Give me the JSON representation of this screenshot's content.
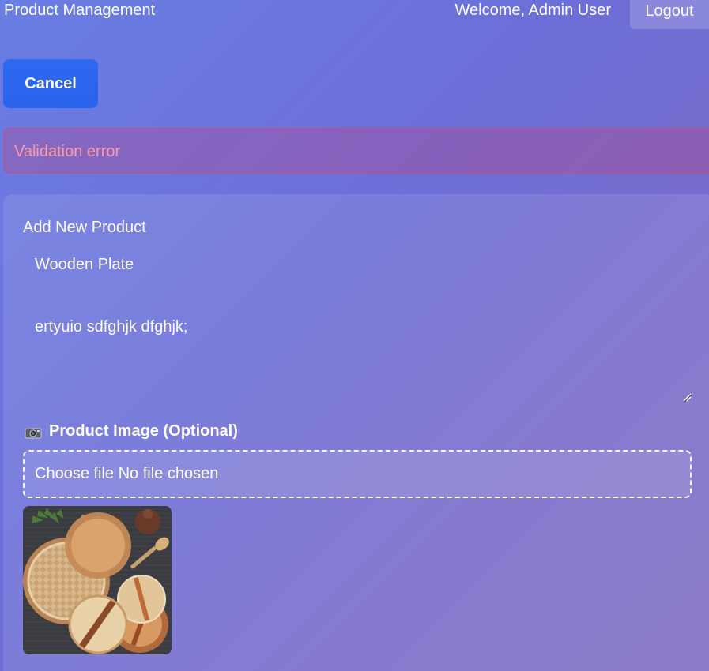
{
  "header": {
    "app_title": "Product Management",
    "welcome_text": "Welcome, Admin User",
    "logout_label": "Logout"
  },
  "actions": {
    "cancel_label": "Cancel"
  },
  "alert": {
    "message": "Validation error"
  },
  "form": {
    "title": "Add New Product",
    "name_value": "Wooden Plate",
    "description_value": "ertyuio sdfghjk dfghjk;",
    "image_label": "Product Image (Optional)",
    "image_icon": "camera-icon",
    "file_input_text": "Choose file No file chosen"
  },
  "colors": {
    "accent": "#2d6af0",
    "error_text": "#ff9aa2",
    "error_border": "#dc466e"
  }
}
